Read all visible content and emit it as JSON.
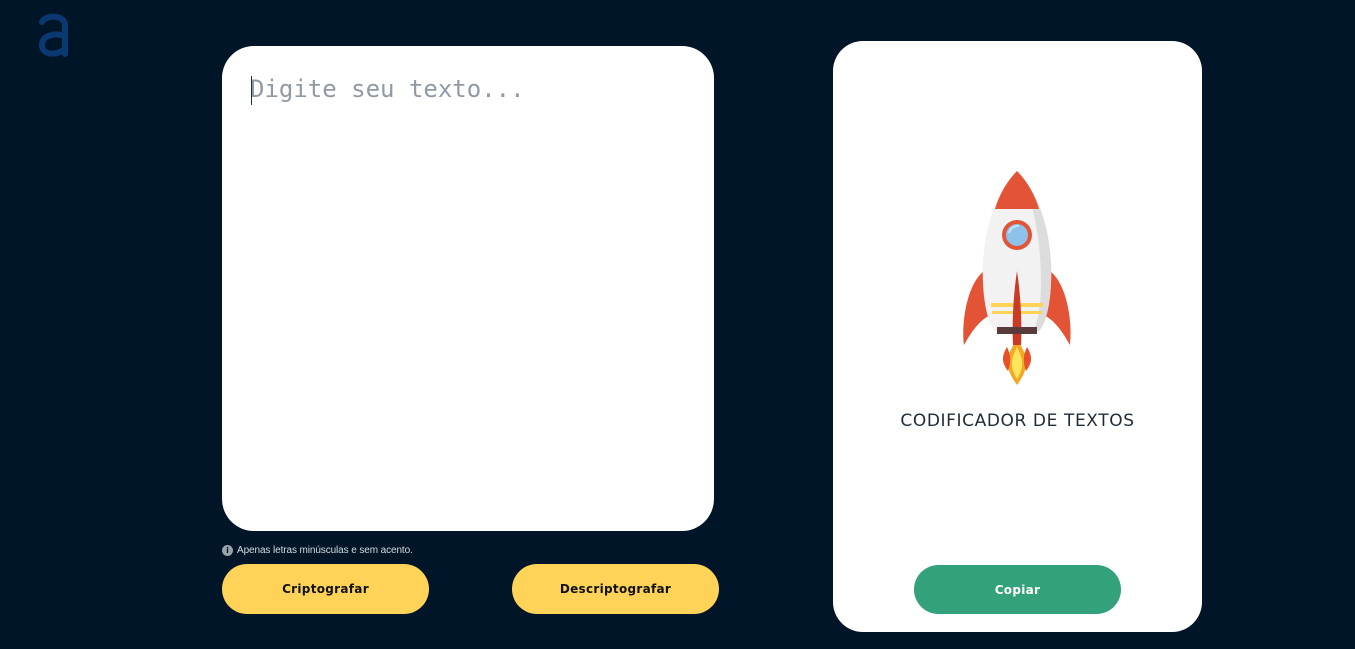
{
  "logo": {
    "icon": "alura-a-logo",
    "color": "#0a3871"
  },
  "input": {
    "placeholder": "Digite seu texto...",
    "value": ""
  },
  "hint": {
    "icon": "info-icon",
    "text": "Apenas letras minúsculas e sem acento."
  },
  "buttons": {
    "encrypt_label": "Criptografar",
    "decrypt_label": "Descriptografar",
    "copy_label": "Copiar"
  },
  "output": {
    "illustration": "rocket-illustration",
    "title": "CODIFICADOR DE TEXTOS"
  },
  "colors": {
    "background": "#011528",
    "card": "#ffffff",
    "primary_button": "#ffd357",
    "copy_button": "#33a17a"
  }
}
